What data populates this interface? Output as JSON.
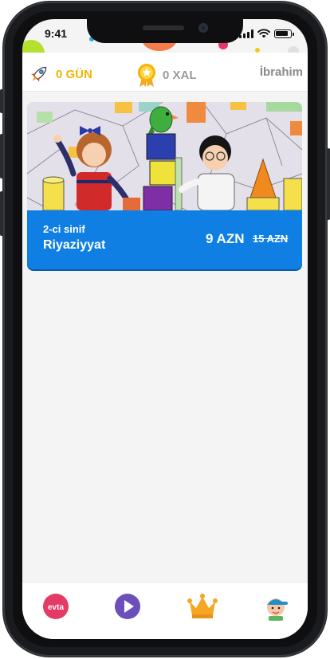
{
  "status_bar": {
    "time": "9:41"
  },
  "header": {
    "streak": {
      "value": "0 GÜN",
      "icon": "rocket-icon"
    },
    "points": {
      "value": "0 XAL",
      "icon": "medal-icon"
    },
    "user_name": "İbrahim"
  },
  "courses": [
    {
      "grade": "2-ci sinif",
      "subject": "Riyaziyyat",
      "price": "9 AZN",
      "old_price": "15 AZN",
      "image": "kids-with-blocks-illustration"
    }
  ],
  "bottom_nav": {
    "items": [
      {
        "icon": "evta-logo-icon",
        "label": "evta"
      },
      {
        "icon": "play-icon"
      },
      {
        "icon": "crown-icon"
      },
      {
        "icon": "profile-avatar-icon"
      }
    ]
  },
  "colors": {
    "accent_blue": "#0f7fe3",
    "streak_yellow": "#f5b400",
    "play_purple": "#6b4fbb",
    "evta_red": "#e33a66",
    "crown_orange": "#f5a623"
  }
}
